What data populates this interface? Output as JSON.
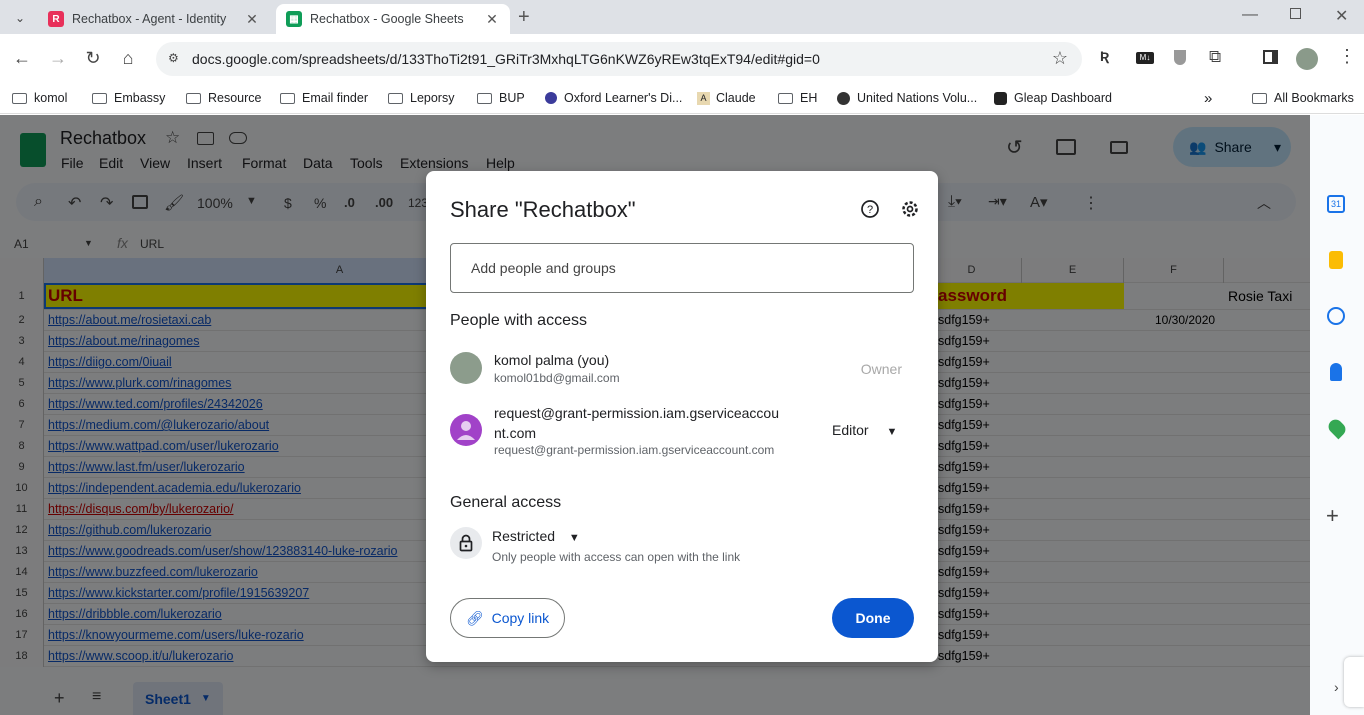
{
  "browser": {
    "tabs": [
      {
        "title": "Rechatbox - Agent - Identity",
        "active": false
      },
      {
        "title": "Rechatbox - Google Sheets",
        "active": true
      }
    ],
    "url": "docs.google.com/spreadsheets/d/133ThoTi2t91_GRiTr3MxhqLTG6nKWZ6yREw3tqExT94/edit#gid=0",
    "bookmarks": [
      "komol",
      "Embassy",
      "Resource",
      "Email finder",
      "Leporsy",
      "BUP",
      "Oxford Learner's Di...",
      "Claude",
      "EH",
      "United Nations Volu...",
      "Gleap Dashboard"
    ],
    "all_bookmarks": "All Bookmarks"
  },
  "sheets": {
    "doc_title": "Rechatbox",
    "menu": [
      "File",
      "Edit",
      "View",
      "Insert",
      "Format",
      "Data",
      "Tools",
      "Extensions",
      "Help"
    ],
    "zoom": "100%",
    "toolbar_symbols": [
      "$",
      "%",
      ".0",
      ".00",
      "123"
    ],
    "cell_ref": "A1",
    "formula": "URL",
    "share_label": "Share",
    "columns": [
      "A",
      "D",
      "E",
      "F"
    ],
    "header_row": {
      "a": "URL",
      "d": "assword",
      "g": "Rosie Taxi"
    },
    "f2": "10/30/2020",
    "rows": [
      {
        "n": "2",
        "a": "https://about.me/rosietaxi.cab",
        "d": "sdfg159+"
      },
      {
        "n": "3",
        "a": "https://about.me/rinagomes",
        "d": "sdfg159+"
      },
      {
        "n": "4",
        "a": "https://diigo.com/0iuail",
        "d": "sdfg159+"
      },
      {
        "n": "5",
        "a": "https://www.plurk.com/rinagomes",
        "d": "sdfg159+"
      },
      {
        "n": "6",
        "a": "https://www.ted.com/profiles/24342026",
        "d": "sdfg159+"
      },
      {
        "n": "7",
        "a": "https://medium.com/@lukerozario/about",
        "d": "sdfg159+"
      },
      {
        "n": "8",
        "a": "https://www.wattpad.com/user/lukerozario",
        "d": "sdfg159+"
      },
      {
        "n": "9",
        "a": "https://www.last.fm/user/lukerozario",
        "d": "sdfg159+"
      },
      {
        "n": "10",
        "a": "https://independent.academia.edu/lukerozario",
        "d": "sdfg159+"
      },
      {
        "n": "11",
        "a": "https://disqus.com/by/lukerozario/",
        "d": "sdfg159+"
      },
      {
        "n": "12",
        "a": "https://github.com/lukerozario",
        "d": "sdfg159+"
      },
      {
        "n": "13",
        "a": "https://www.goodreads.com/user/show/123883140-luke-rozario",
        "d": "sdfg159+"
      },
      {
        "n": "14",
        "a": "https://www.buzzfeed.com/lukerozario",
        "d": "sdfg159+"
      },
      {
        "n": "15",
        "a": "https://www.kickstarter.com/profile/1915639207",
        "d": "sdfg159+"
      },
      {
        "n": "16",
        "a": "https://dribbble.com/lukerozario",
        "d": "sdfg159+"
      },
      {
        "n": "17",
        "a": "https://knowyourmeme.com/users/luke-rozario",
        "d": "sdfg159+"
      },
      {
        "n": "18",
        "a": "https://www.scoop.it/u/lukerozario",
        "d": "sdfg159+"
      }
    ],
    "sheet_tab": "Sheet1"
  },
  "dialog": {
    "title": "Share \"Rechatbox\"",
    "add_placeholder": "Add people and groups",
    "people_heading": "People with access",
    "people": [
      {
        "name": "komol palma (you)",
        "email": "komol01bd@gmail.com",
        "role": "Owner"
      },
      {
        "name_line1": "request@grant-permission.iam.gserviceaccou",
        "name_line2": "nt.com",
        "email": "request@grant-permission.iam.gserviceaccount.com",
        "role": "Editor"
      }
    ],
    "general_heading": "General access",
    "access_level": "Restricted",
    "access_desc": "Only people with access can open with the link",
    "copy_link": "Copy link",
    "done": "Done"
  },
  "colors": {
    "accent": "#0b57d0",
    "header_yellow": "#ffff00",
    "header_red": "#cc0000",
    "sheets_green": "#0f9d58"
  }
}
